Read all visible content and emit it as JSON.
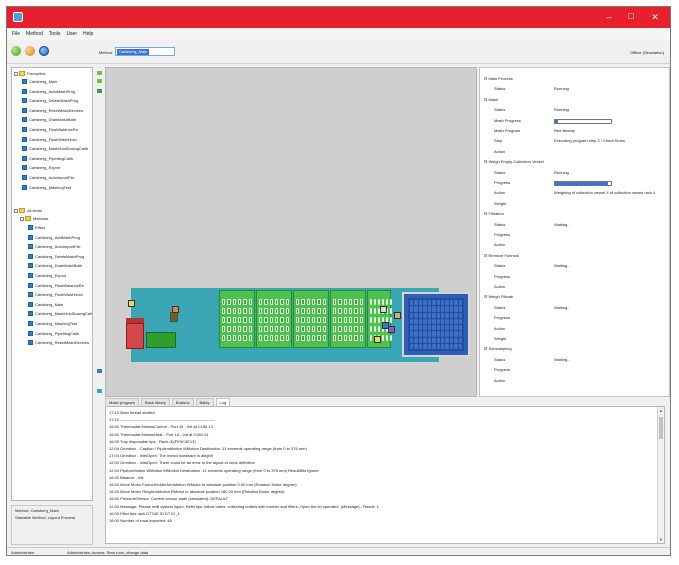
{
  "window": {
    "title": ""
  },
  "menu": [
    "File",
    "Method",
    "Tools",
    "User",
    "Help"
  ],
  "toolbar": {
    "method_label": "Method",
    "method_value": "Carlsberg_Main",
    "mode": "Offline (Simulation)",
    "icons": [
      "run-green-icon",
      "run-orange-icon",
      "info-blue-icon"
    ]
  },
  "tree": {
    "favorites_label": "Favourites",
    "favorites": [
      "Carlsberg_Main",
      "Carlsberg_AutoMashProg",
      "Carlsberg_DeleteMashProg",
      "Carlsberg_ResetMashDevices",
      "Carlsberg_DrainMashBath",
      "Carlsberg_FlushBalanceRe",
      "Carlsberg_FlushWashHold",
      "Carlsberg_MashHoldDosingCalib",
      "Carlsberg_PipettingCalib",
      "Carlsberg_Export",
      "Carlsberg_AutoImportFile",
      "Carlsberg_MashingTest"
    ],
    "all_items_label": "All items",
    "methods_label": "Methods",
    "methods": [
      "Effect",
      "Carlsberg_AddMashProg",
      "Carlsberg_AutoImportFile",
      "Carlsberg_DeleteMashProg",
      "Carlsberg_DrainMashBath",
      "Carlsberg_Export",
      "Carlsberg_FlushBalanceRe",
      "Carlsberg_FlushWashHold",
      "Carlsberg_Main",
      "Carlsberg_MashHoldDosingCalib",
      "Carlsberg_MashingTest",
      "Carlsberg_PipettingCalib",
      "Carlsberg_ResetMashDevices"
    ]
  },
  "left_status": {
    "line1": "Method: Carlsberg_Main",
    "line2": "Startable Method, Layout Process"
  },
  "properties": [
    {
      "type": "group",
      "key": "Main Process"
    },
    {
      "type": "item",
      "key": "Status",
      "value": "Running"
    },
    {
      "type": "group",
      "key": "Mash"
    },
    {
      "type": "item",
      "key": "Status",
      "value": "Running"
    },
    {
      "type": "item",
      "key": "Mash Progress",
      "progress": 0.05
    },
    {
      "type": "item",
      "key": "Mash Program",
      "value": "Red Beauty"
    },
    {
      "type": "item",
      "key": "Step",
      "value": "Executing program step 3 / CheckTimes"
    },
    {
      "type": "item",
      "key": "Action",
      "value": ""
    },
    {
      "type": "group",
      "key": "Weigh Empty Collection Vessel"
    },
    {
      "type": "item",
      "key": "Status",
      "value": "Running"
    },
    {
      "type": "item",
      "key": "Progress",
      "progress": 0.95
    },
    {
      "type": "item",
      "key": "Action",
      "value": "Weighing of collection vessel 4 of collection vessel rack 4"
    },
    {
      "type": "item",
      "key": "Weight",
      "value": ""
    },
    {
      "type": "group",
      "key": "Filtration"
    },
    {
      "type": "item",
      "key": "Status",
      "value": "Waiting..."
    },
    {
      "type": "item",
      "key": "Progress",
      "value": ""
    },
    {
      "type": "item",
      "key": "Action",
      "value": ""
    },
    {
      "type": "group",
      "key": "Remove Funnels"
    },
    {
      "type": "item",
      "key": "Status",
      "value": "Waiting..."
    },
    {
      "type": "item",
      "key": "Progress",
      "value": ""
    },
    {
      "type": "item",
      "key": "Action",
      "value": ""
    },
    {
      "type": "group",
      "key": "Weigh Filtrate"
    },
    {
      "type": "item",
      "key": "Status",
      "value": "Waiting..."
    },
    {
      "type": "item",
      "key": "Progress",
      "value": ""
    },
    {
      "type": "item",
      "key": "Action",
      "value": ""
    },
    {
      "type": "item",
      "key": "Weight",
      "value": ""
    },
    {
      "type": "group",
      "key": "Subsampling"
    },
    {
      "type": "item",
      "key": "Status",
      "value": "Waiting..."
    },
    {
      "type": "item",
      "key": "Progress",
      "value": ""
    },
    {
      "type": "item",
      "key": "Action",
      "value": ""
    }
  ],
  "tabs": [
    "Mash program",
    "Rack library",
    "Buttons",
    "Balay",
    "Log"
  ],
  "active_tab": "Log",
  "log": [
    "17:10 Main thread started",
    "17:10 -----------------------------------------------------------------------",
    "16:00 Thermostat MulsesControl - Port 15 - Init at COM 13",
    "16:00 Thermostat MulsesHeat - Port 16 - Init at COM 14",
    "16:00 Tray disposable tips - Rack-ID(FE9C9E13)",
    "12:04 Omnibox - Caption / PipArmMotion WMotion Destination -11 exceeds operating range (from 0 to 376 mm)",
    "17:04 Omnibox - InitsOpen: The mixsvi hardware is alright!",
    "12:04 Omnibox - InitsOpen: There could be an error in the layout or deck definition",
    "12:04 PipArmMotion WMotion WMotion Destination -11 exceeds operating range (from 0 to 376 mm) ResultBits Ignore",
    "16:00 Balance - Init",
    "16:00 Move Motor FunnelHolderArmMotion WMotor to absolute position 0.00 mm (Rotation Motor degree)",
    "16:00 Move Motor RingArmMotion RMotor to absolute position 180.00 mm (Rotation Motor degree)",
    "16:00 PressureSensor: Current sensor state (simulated): DEFAULT",
    "12:04 Message: Please refill system liquid. Refill tips, fallow tubes, collecting bottles with funnels and filters. Open the lid operated. (Message) - Result: 1",
    "16:00 Filter tips rack D77AE ID D7 ID_1",
    "16:00 Number of rows imported: 48"
  ],
  "status": {
    "user": "Administrator",
    "rights": "Administrator Access: Start runs, change data"
  },
  "colors": {
    "titlebar": "#e81f2c",
    "deck": "#cfcfcf",
    "base": "#3aa6b5",
    "carrier": "#4fc04f",
    "plate": "#2f5fb6"
  }
}
